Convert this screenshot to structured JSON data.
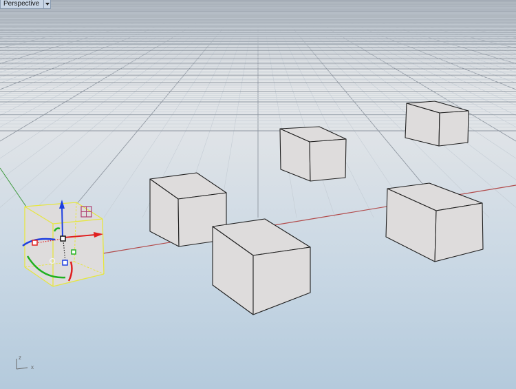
{
  "viewport": {
    "label": "Perspective",
    "active": true
  },
  "axes_widget": {
    "z_label": "z",
    "x_label": "x"
  },
  "colors": {
    "grid_minor": "#c4ccd4",
    "grid_major": "#8e96a0",
    "x_axis": "#b24a4a",
    "y_axis": "#3f9a3f",
    "box_face": "#dedcdc",
    "box_edge": "#1e1e1e",
    "selection": "#e6e640",
    "gumball_x": "#e02020",
    "gumball_y": "#20b020",
    "gumball_z": "#1d3fe0"
  },
  "objects": [
    {
      "name": "box",
      "selected": true
    },
    {
      "name": "box",
      "selected": false
    },
    {
      "name": "box",
      "selected": false
    },
    {
      "name": "box",
      "selected": false
    },
    {
      "name": "box",
      "selected": false
    },
    {
      "name": "box",
      "selected": false
    }
  ]
}
